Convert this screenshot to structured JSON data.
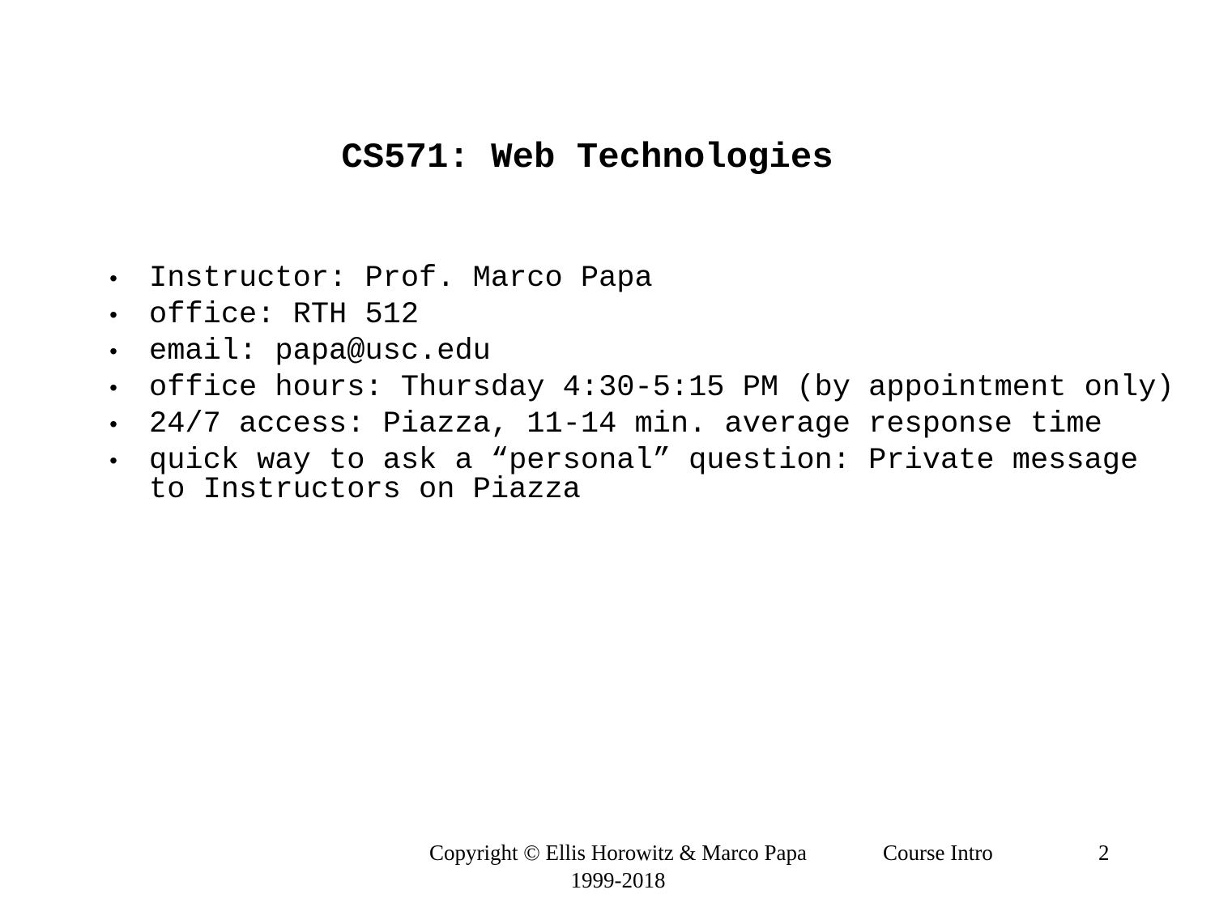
{
  "slide": {
    "title": "CS571: Web Technologies",
    "bullet_glyph": "•",
    "bullets": [
      "Instructor: Prof. Marco Papa",
      "office: RTH 512",
      "email: papa@usc.edu",
      "office hours: Thursday 4:30-5:15 PM (by appointment only)",
      "24/7 access: Piazza, 11-14 min. average response time",
      "quick way to ask a “personal” question: Private message to Instructors on Piazza"
    ]
  },
  "footer": {
    "copyright_line1": "Copyright  © Ellis Horowitz & Marco Papa",
    "copyright_line2": "1999-2018",
    "course_label": "Course Intro",
    "page_number": "2"
  }
}
